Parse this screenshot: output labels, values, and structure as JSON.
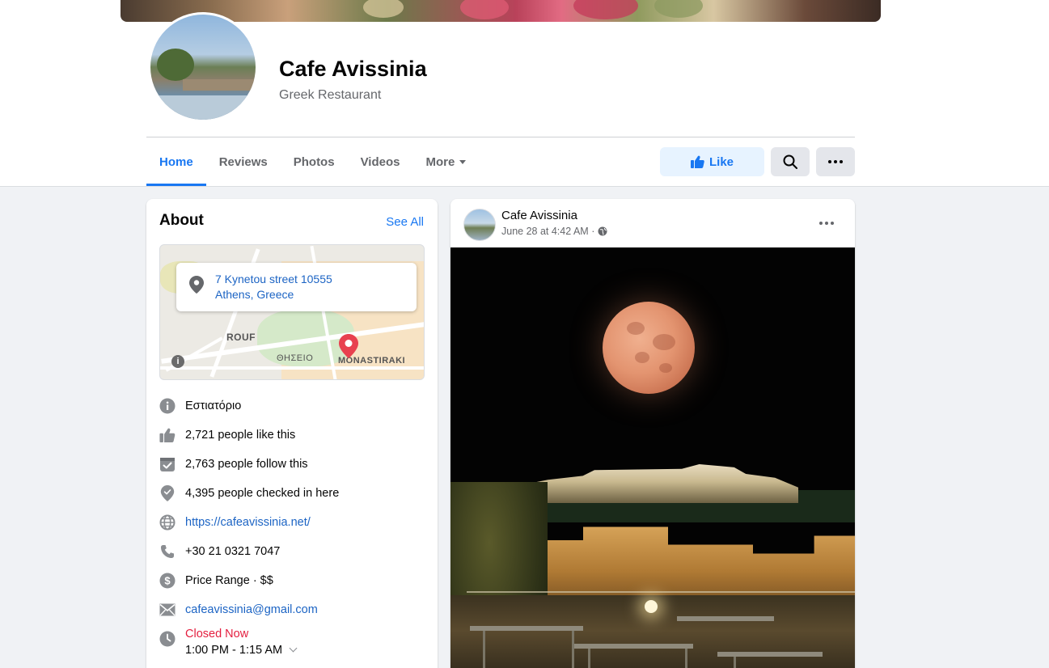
{
  "page": {
    "name": "Cafe Avissinia",
    "category": "Greek Restaurant"
  },
  "tabs": [
    {
      "label": "Home",
      "active": true
    },
    {
      "label": "Reviews",
      "active": false
    },
    {
      "label": "Photos",
      "active": false
    },
    {
      "label": "Videos",
      "active": false
    },
    {
      "label": "More",
      "active": false
    }
  ],
  "actions": {
    "like_label": "Like",
    "search_icon": "search-icon",
    "more_icon": "more-horizontal-icon"
  },
  "about": {
    "title": "About",
    "see_all": "See All",
    "address_line1": "7 Kynetou street 10555",
    "address_line2": "Athens, Greece",
    "map_labels": {
      "rouf": "ROUF",
      "thiseio": "ΘΗΣΕΙΟ",
      "monastiraki": "MONASTIRAKI"
    },
    "items": {
      "category": "Εστιατόριο",
      "likes": "2,721 people like this",
      "follows": "2,763 people follow this",
      "checkins": "4,395 people checked in here",
      "website": "https://cafeavissinia.net/",
      "phone": "+30 21 0321 7047",
      "price": "Price Range · $$",
      "email": "cafeavissinia@gmail.com",
      "status": "Closed Now",
      "hours": "1:00 PM - 1:15 AM"
    }
  },
  "post": {
    "author": "Cafe Avissinia",
    "timestamp": "June 28 at 4:42 AM ·",
    "privacy_icon": "globe-icon"
  },
  "colors": {
    "accent": "#1877f2",
    "link": "#1c64c4",
    "closed": "#e41e3f",
    "background": "#f0f2f5"
  }
}
